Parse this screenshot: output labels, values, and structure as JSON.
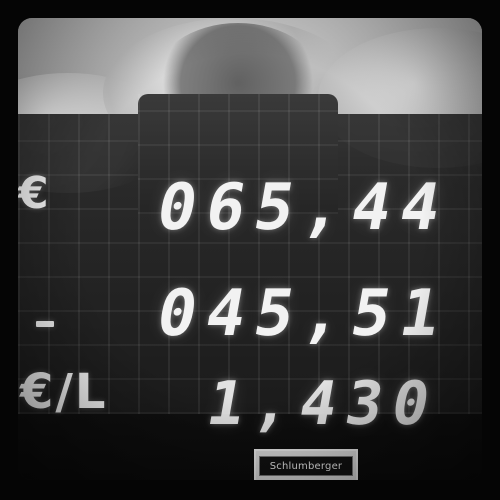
{
  "meter": {
    "amount": "065,44",
    "liters": "045,51",
    "unit_price": "1,430",
    "labels": {
      "currency": "€",
      "price_per_liter": "€/L"
    },
    "brand": "Schlumberger"
  },
  "colors": {
    "digits": "#F2F2F2",
    "frame": "#050505"
  }
}
